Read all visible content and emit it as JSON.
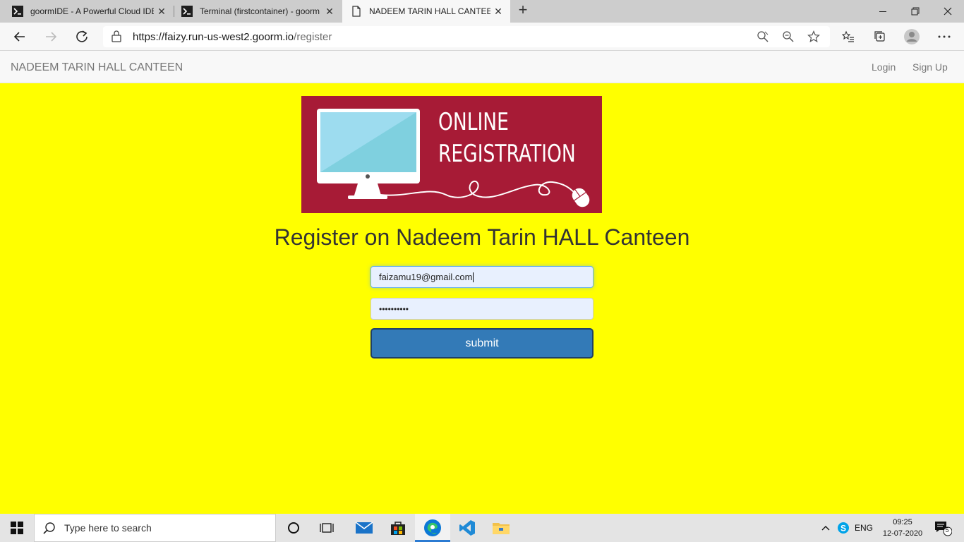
{
  "browser": {
    "tabs": [
      {
        "title": "goormIDE - A Powerful Cloud IDE",
        "icon": "terminal-icon"
      },
      {
        "title": "Terminal (firstcontainer) - goorm",
        "icon": "terminal-icon"
      },
      {
        "title": "NADEEM TARIN HALL CANTEEN",
        "icon": "page-icon",
        "active": true
      }
    ],
    "url_host": "https://faizy.run-us-west2.goorm.io",
    "url_path": "/register"
  },
  "site": {
    "brand": "NADEEM TARIN HALL CANTEEN",
    "nav": {
      "login": "Login",
      "signup": "Sign Up"
    }
  },
  "banner": {
    "line1": "ONLINE",
    "line2": "REGISTRATION",
    "colors": {
      "background": "#a71b36",
      "screen": "#9ddcef",
      "monitor": "#ffffff"
    }
  },
  "page": {
    "title": "Register on Nadeem Tarin HALL Canteen",
    "email_value": "faizamu19@gmail.com",
    "password_value": "••••••••••",
    "submit_label": "submit"
  },
  "taskbar": {
    "search_placeholder": "Type here to search",
    "language": "ENG",
    "time": "09:25",
    "date": "12-07-2020",
    "notification_count": "5"
  },
  "colors": {
    "page_background": "#ffff00",
    "button": "#337ab7"
  }
}
